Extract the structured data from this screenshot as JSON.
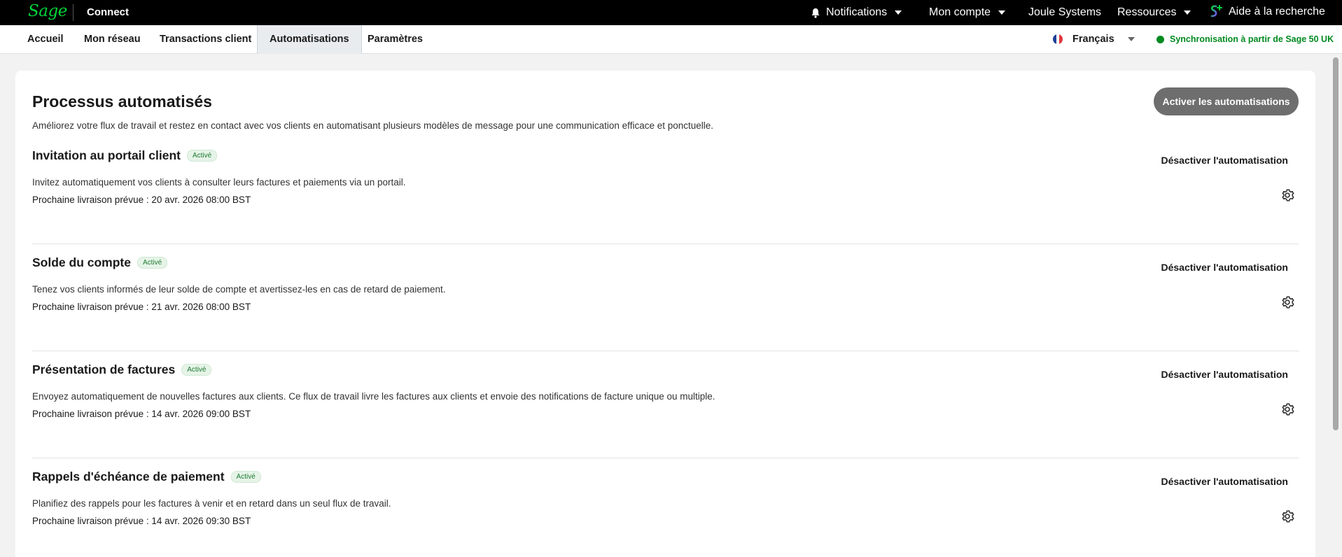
{
  "topbar": {
    "logo_text": "Sage",
    "product": "Connect",
    "notifications_label": "Notifications",
    "account_label": "Mon compte",
    "company_label": "Joule Systems",
    "resources_label": "Ressources",
    "help_label": "Aide à la recherche"
  },
  "nav": {
    "tabs": [
      {
        "label": "Accueil"
      },
      {
        "label": "Mon réseau"
      },
      {
        "label": "Transactions client"
      },
      {
        "label": "Automatisations",
        "active": true
      },
      {
        "label": "Paramètres"
      }
    ],
    "language": "Français",
    "sync_text": "Synchronisation à partir de Sage 50 UK"
  },
  "main": {
    "title": "Processus automatisés",
    "description": "Améliorez votre flux de travail et restez en contact avec vos clients en automatisant plusieurs modèles de message pour une communication efficace et ponctuelle.",
    "activate_button": "Activer les automatisations",
    "items": [
      {
        "title": "Invitation au portail client",
        "status": "Activé",
        "description": "Invitez automatiquement vos clients à consulter leurs factures et paiements via un portail.",
        "next_delivery": "Prochaine livraison prévue : 20 avr. 2026 08:00 BST",
        "action": "Désactiver l'automatisation"
      },
      {
        "title": "Solde du compte",
        "status": "Activé",
        "description": "Tenez vos clients informés de leur solde de compte et avertissez-les en cas de retard de paiement.",
        "next_delivery": "Prochaine livraison prévue : 21 avr. 2026 08:00 BST",
        "action": "Désactiver l'automatisation"
      },
      {
        "title": "Présentation de factures",
        "status": "Activé",
        "description": "Envoyez automatiquement de nouvelles factures aux clients. Ce flux de travail livre les factures aux clients et envoie des notifications de facture unique ou multiple.",
        "next_delivery": "Prochaine livraison prévue : 14 avr. 2026 09:00 BST",
        "action": "Désactiver l'automatisation"
      },
      {
        "title": "Rappels d'échéance de paiement",
        "status": "Activé",
        "description": "Planifiez des rappels pour les factures à venir et en retard dans un seul flux de travail.",
        "next_delivery": "Prochaine livraison prévue : 14 avr. 2026 09:30 BST",
        "action": "Désactiver l'automatisation"
      }
    ]
  },
  "colors": {
    "brand_green": "#00d639",
    "sync_green": "#008a20",
    "badge_bg": "#e6f4e8",
    "button_gray": "#6e6e6e"
  },
  "icons": [
    "bell-icon",
    "caret-down-icon",
    "sage-copilot-icon",
    "france-flag-icon",
    "status-dot-icon",
    "gear-icon"
  ]
}
